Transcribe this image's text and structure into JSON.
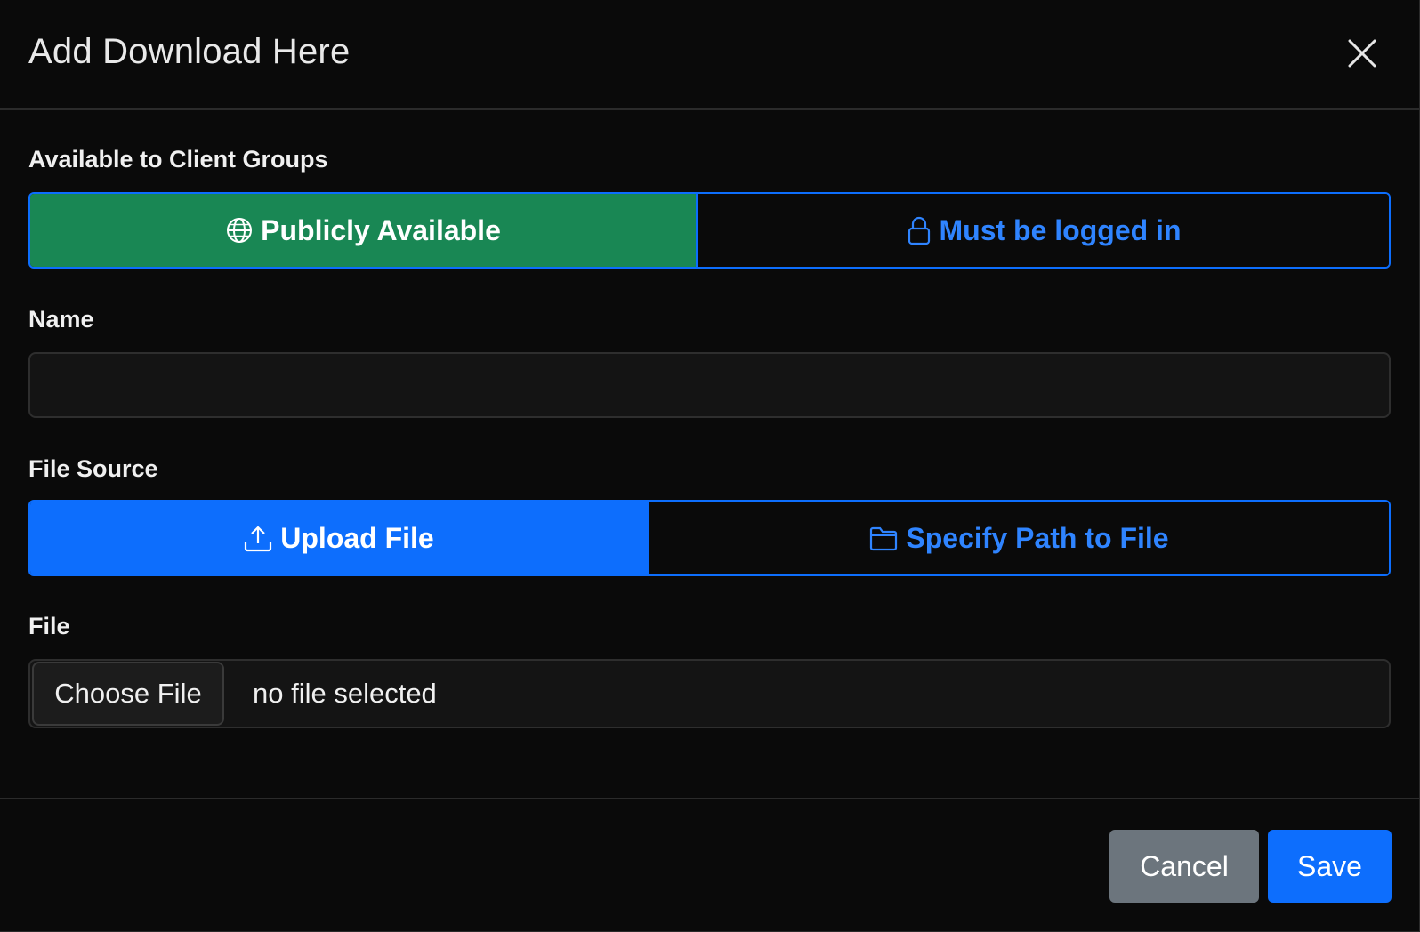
{
  "modal": {
    "title": "Add Download Here"
  },
  "client_groups": {
    "label": "Available to Client Groups",
    "options": [
      {
        "label": "Publicly Available",
        "icon": "globe-icon",
        "selected": true,
        "color": "#198754"
      },
      {
        "label": "Must be logged in",
        "icon": "lock-icon",
        "selected": false,
        "color": "#0d6efd"
      }
    ]
  },
  "name_field": {
    "label": "Name",
    "value": "",
    "placeholder": ""
  },
  "file_source": {
    "label": "File Source",
    "options": [
      {
        "label": "Upload File",
        "icon": "upload-icon",
        "selected": true,
        "color": "#0d6efd"
      },
      {
        "label": "Specify Path to File",
        "icon": "folder-icon",
        "selected": false,
        "color": "#0d6efd"
      }
    ]
  },
  "file_field": {
    "label": "File",
    "button_label": "Choose File",
    "status": "no file selected"
  },
  "footer": {
    "cancel_label": "Cancel",
    "save_label": "Save"
  },
  "colors": {
    "background": "#0a0a0a",
    "success": "#198754",
    "primary": "#0d6efd",
    "secondary": "#6c757d"
  }
}
